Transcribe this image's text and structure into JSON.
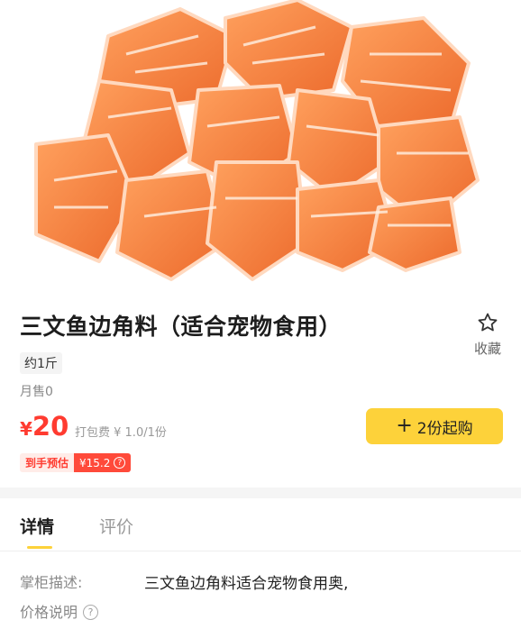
{
  "product": {
    "image_alt": "salmon cubes",
    "title": "三文鱼边角料（适合宠物食用）",
    "spec": "约1斤",
    "monthly_sales": "月售0",
    "price_currency": "¥",
    "price_value": "20",
    "packaging_fee": "打包费 ¥ 1.0/1份",
    "estimate_label": "到手预估",
    "estimate_value": "¥15.2"
  },
  "actions": {
    "favorite_label": "收藏",
    "buy_label": "2份起购",
    "buy_plus": "+"
  },
  "tabs": [
    {
      "label": "详情",
      "active": true
    },
    {
      "label": "评价",
      "active": false
    }
  ],
  "details": {
    "description_label": "掌柜描述:",
    "description_value": "三文鱼边角料适合宠物食用奥,",
    "price_note_label": "价格说明",
    "help_glyph": "?"
  },
  "colors": {
    "accent_yellow": "#fdd23a",
    "price_red": "#ff3b30",
    "salmon": "#f27a3b"
  },
  "icons": {
    "favorite": "star-outline-icon",
    "help": "question-circle-icon"
  }
}
